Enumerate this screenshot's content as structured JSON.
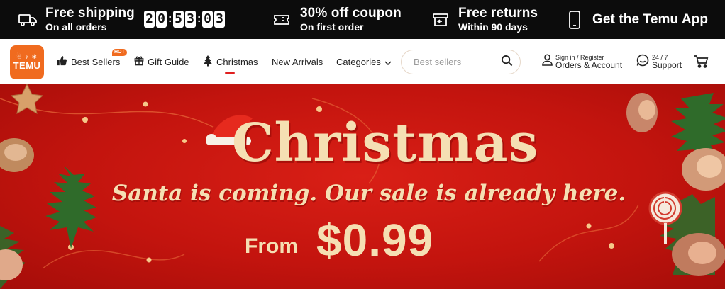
{
  "promo": {
    "shipping": {
      "title": "Free shipping",
      "sub": "On all orders",
      "icon": "truck-icon"
    },
    "timer": {
      "digits": [
        "2",
        "0",
        "5",
        "3",
        "0",
        "3"
      ]
    },
    "coupon": {
      "title": "30% off coupon",
      "sub": "On first order",
      "icon": "ticket-icon"
    },
    "returns": {
      "title": "Free returns",
      "sub": "Within 90 days",
      "icon": "return-box-icon"
    },
    "app": {
      "title": "Get the Temu App",
      "icon": "phone-icon"
    }
  },
  "header": {
    "logo": {
      "mark": "☃ ♪ ❄",
      "word": "TEMU",
      "color": "#f06b1f"
    },
    "nav": {
      "best_sellers": "Best Sellers",
      "hot_badge": "HOT",
      "gift_guide": "Gift Guide",
      "christmas": "Christmas",
      "new_arrivals": "New Arrivals",
      "categories": "Categories"
    },
    "search": {
      "placeholder": "Best sellers",
      "value": ""
    },
    "account": {
      "small": "Sign in / Register",
      "big": "Orders & Account"
    },
    "support": {
      "small": "24 / 7",
      "big": "Support"
    }
  },
  "banner": {
    "title": "Christmas",
    "subtitle": "Santa is coming. Our sale is already here.",
    "from": "From",
    "price": "$0.99",
    "background": "#c3140e",
    "text_color": "#f5dfb3"
  }
}
